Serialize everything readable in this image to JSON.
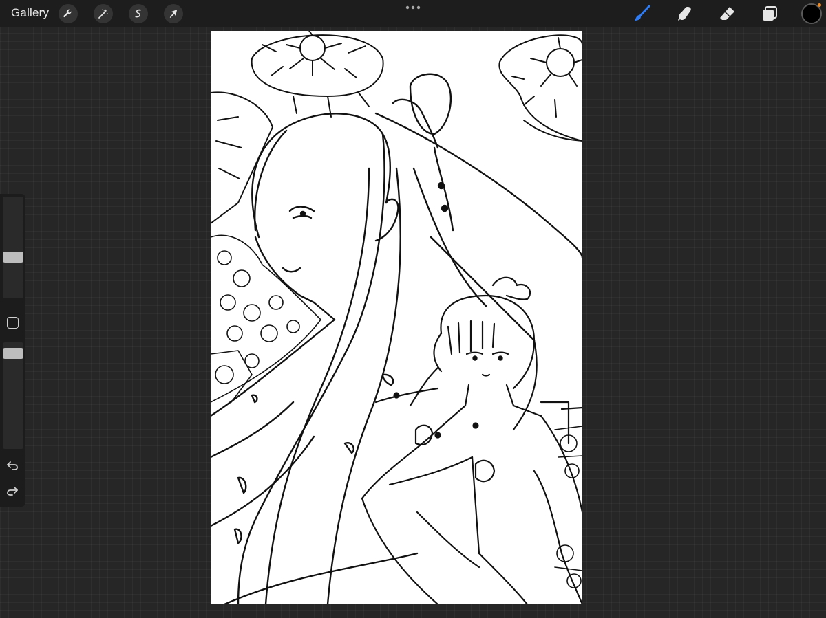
{
  "topbar": {
    "gallery_label": "Gallery",
    "left_tools": [
      {
        "name": "actions",
        "icon": "wrench-icon"
      },
      {
        "name": "adjustments",
        "icon": "magic-wand-icon"
      },
      {
        "name": "selection",
        "icon": "selection-s-icon"
      },
      {
        "name": "transform",
        "icon": "arrow-cursor-icon"
      }
    ],
    "center_menu_icon": "more-dots-icon",
    "right_tools": [
      {
        "name": "brush",
        "icon": "brush-icon",
        "active": true,
        "color": "#2f7df6"
      },
      {
        "name": "smudge",
        "icon": "smudge-finger-icon",
        "active": false
      },
      {
        "name": "eraser",
        "icon": "eraser-icon",
        "active": false
      },
      {
        "name": "layers",
        "icon": "layers-icon",
        "active": false
      }
    ],
    "current_color": "#000000",
    "color_indicator": "#f08a24"
  },
  "sidebar": {
    "brush_size_icon": "brush-size-slider",
    "modify_icon": "modify-square-icon",
    "opacity_icon": "opacity-slider",
    "undo_icon": "undo-icon",
    "redo_icon": "redo-icon"
  },
  "canvas": {
    "background": "#ffffff",
    "content": "line-art-illustration"
  },
  "theme": {
    "bar_bg": "#1d1d1d",
    "workspace_bg": "#262626",
    "icon_color": "#e6e6e6"
  }
}
